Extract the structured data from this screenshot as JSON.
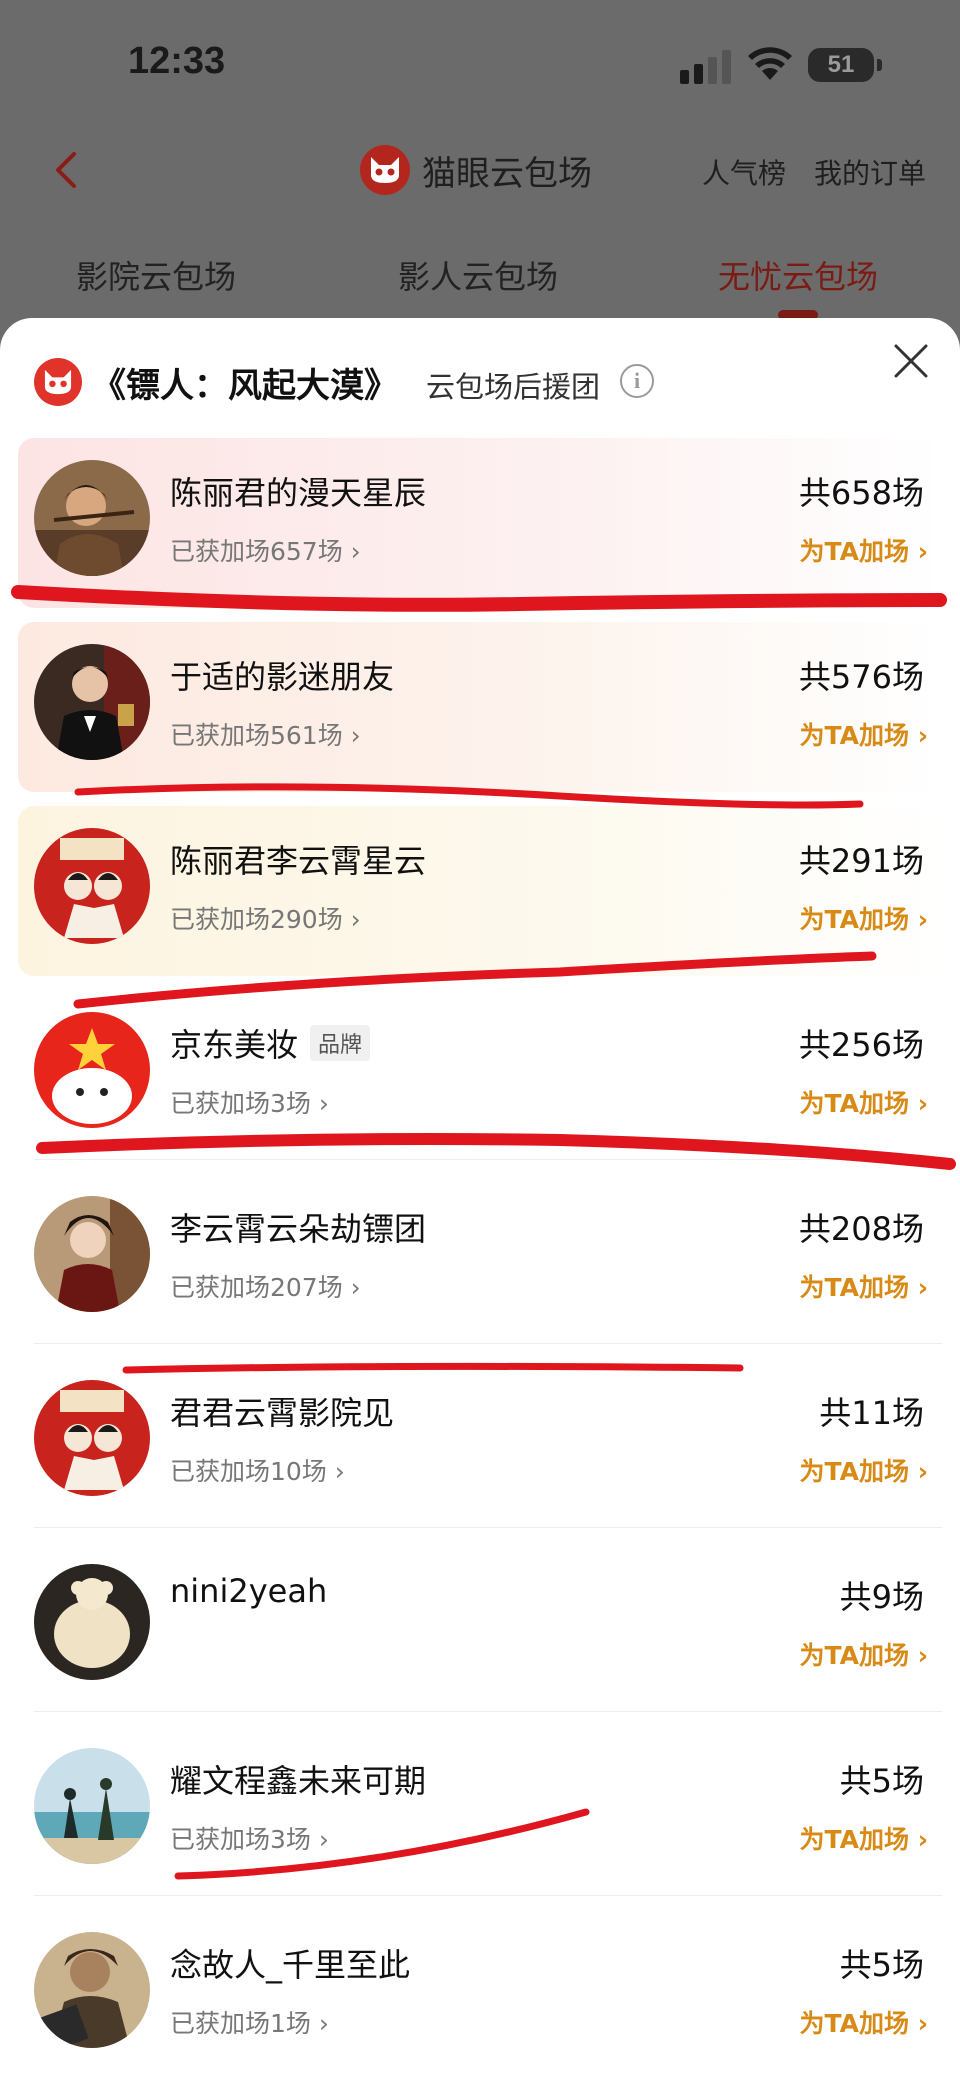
{
  "status_bar": {
    "time": "12:33",
    "battery": "51"
  },
  "nav": {
    "title": "猫眼云包场",
    "links": [
      "人气榜",
      "我的订单"
    ]
  },
  "tabs": [
    {
      "label": "影院云包场",
      "active": false
    },
    {
      "label": "影人云包场",
      "active": false
    },
    {
      "label": "无忧云包场",
      "active": true
    }
  ],
  "sheet": {
    "movie_title": "《镖人：风起大漠》",
    "suffix": "云包场后援团"
  },
  "items": [
    {
      "name": "陈丽君的漫天星辰",
      "sub": "已获加场657场 ›",
      "total": "共658场",
      "action": "为TA加场 ›",
      "tag": ""
    },
    {
      "name": "于适的影迷朋友",
      "sub": "已获加场561场 ›",
      "total": "共576场",
      "action": "为TA加场 ›",
      "tag": ""
    },
    {
      "name": "陈丽君李云霄星云",
      "sub": "已获加场290场 ›",
      "total": "共291场",
      "action": "为TA加场 ›",
      "tag": ""
    },
    {
      "name": "京东美妆",
      "sub": "已获加场3场 ›",
      "total": "共256场",
      "action": "为TA加场 ›",
      "tag": "品牌"
    },
    {
      "name": "李云霄云朵劫镖团",
      "sub": "已获加场207场 ›",
      "total": "共208场",
      "action": "为TA加场 ›",
      "tag": ""
    },
    {
      "name": "君君云霄影院见",
      "sub": "已获加场10场 ›",
      "total": "共11场",
      "action": "为TA加场 ›",
      "tag": ""
    },
    {
      "name": "nini2yeah",
      "sub": "",
      "total": "共9场",
      "action": "为TA加场 ›",
      "tag": ""
    },
    {
      "name": "耀文程鑫未来可期",
      "sub": "已获加场3场 ›",
      "total": "共5场",
      "action": "为TA加场 ›",
      "tag": ""
    },
    {
      "name": "念故人_千里至此",
      "sub": "已获加场1场 ›",
      "total": "共5场",
      "action": "为TA加场 ›",
      "tag": ""
    }
  ],
  "colors": {
    "accent_red": "#e0342b",
    "action_orange": "#d88a17",
    "markup_red": "#e0161e"
  }
}
